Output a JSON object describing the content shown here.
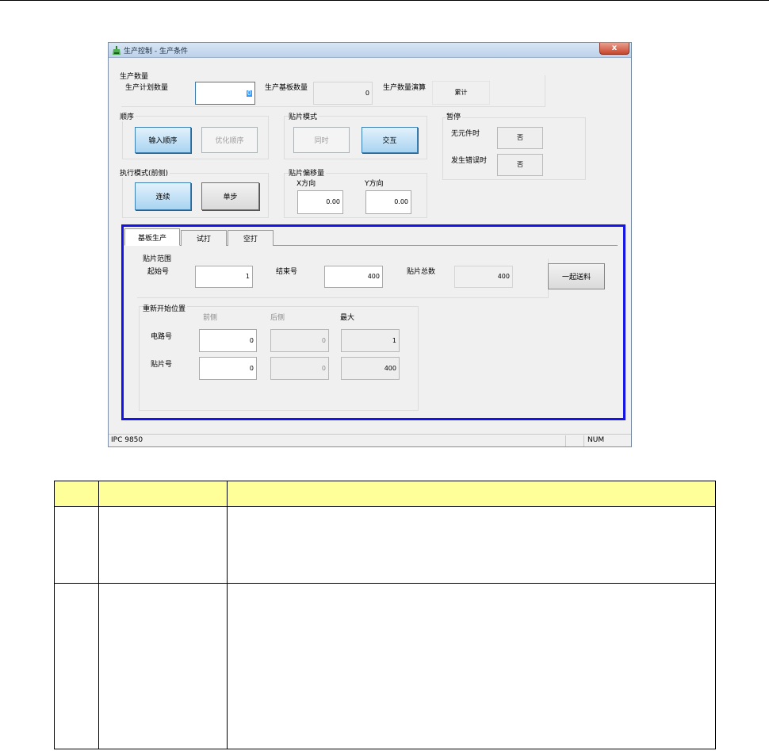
{
  "window": {
    "title": "生产控制 - 生产条件",
    "close_label": "x"
  },
  "production_qty": {
    "group_label": "生产数量",
    "plan_label": "生产计划数量",
    "plan_value": "0",
    "board_label": "生产基板数量",
    "board_value": "0",
    "calc_label": "生产数量演算",
    "calc_value": "累计"
  },
  "order": {
    "label": "顺序",
    "input_btn": "输入顺序",
    "optimize_btn": "优化顺序"
  },
  "mount_mode": {
    "label": "贴片模式",
    "simultaneous_btn": "同时",
    "alternate_btn": "交互"
  },
  "pause": {
    "label": "暂停",
    "no_parts_label": "无元件时",
    "no_parts_value": "否",
    "error_label": "发生错误时",
    "error_value": "否"
  },
  "exec_mode": {
    "label": "执行模式(前侧)",
    "continuous_btn": "连续",
    "step_btn": "单步"
  },
  "offset": {
    "label": "贴片偏移量",
    "x_label": "X方向",
    "x_value": "0.00",
    "y_label": "Y方向",
    "y_value": "0.00"
  },
  "tabs": [
    "基板生产",
    "试打",
    "空打"
  ],
  "range": {
    "label": "贴片范围",
    "start_label": "起始号",
    "start_value": "1",
    "end_label": "结束号",
    "end_value": "400",
    "total_label": "贴片总数",
    "total_value": "400",
    "feed_btn": "一起送料"
  },
  "restart": {
    "label": "重新开始位置",
    "col_front": "前侧",
    "col_rear": "后侧",
    "col_max": "最大",
    "row1_label": "电路号",
    "row1_front": "0",
    "row1_rear": "0",
    "row1_max": "1",
    "row2_label": "贴片号",
    "row2_front": "0",
    "row2_rear": "0",
    "row2_max": "400"
  },
  "status": {
    "left": "IPC 9850",
    "right": "NUM"
  },
  "colors": {
    "highlight": "#1414e6",
    "table_header": "#ffff99"
  }
}
